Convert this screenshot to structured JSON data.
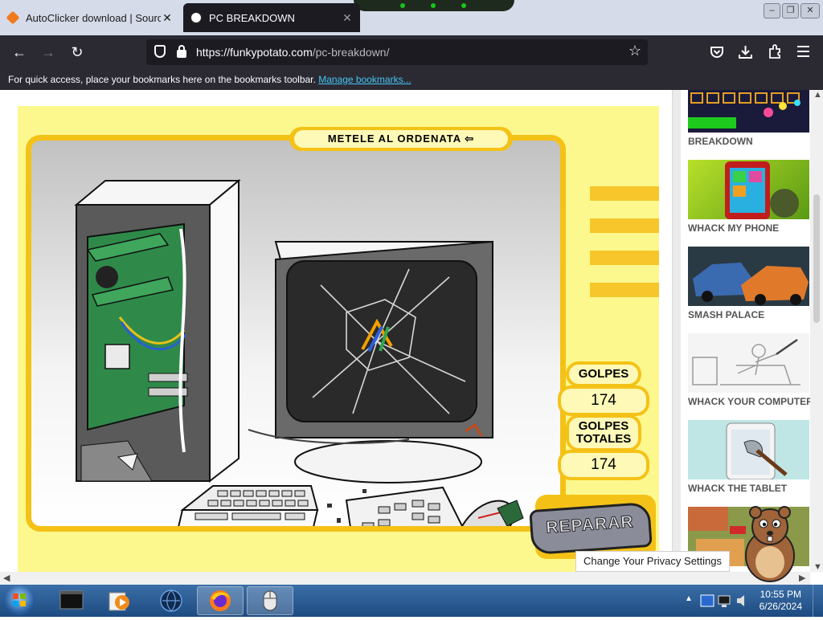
{
  "tabs": [
    {
      "title": "AutoClicker download | Sourcef",
      "close": "✕"
    },
    {
      "title": "PC BREAKDOWN",
      "close": "✕"
    }
  ],
  "window_controls": {
    "minimize": "–",
    "maximize": "❐",
    "close": "✕"
  },
  "nav": {
    "back": "←",
    "forward": "→",
    "reload": "↻"
  },
  "url": {
    "domain": "https://funkypotato.com",
    "path": "/pc-breakdown/"
  },
  "toolbar_icons": [
    "pocket-icon",
    "download-icon",
    "extensions-icon",
    "menu-icon"
  ],
  "bookmarks_bar": {
    "message": "For quick access, place your bookmarks here on the bookmarks toolbar.",
    "link": "Manage bookmarks..."
  },
  "game": {
    "title": "METELE AL ORDENATA",
    "hits_label": "GOLPES",
    "hits_value": "174",
    "total_label_line1": "GOLPES",
    "total_label_line2": "TOTALES",
    "total_value": "174",
    "repair_button": "REPARAR"
  },
  "sidebar": {
    "games": [
      {
        "name": "BREAKDOWN"
      },
      {
        "name": "WHACK MY PHONE"
      },
      {
        "name": "SMASH PALACE"
      },
      {
        "name": "WHACK YOUR COMPUTER"
      },
      {
        "name": "WHACK THE TABLET"
      }
    ]
  },
  "privacy_button": "Change Your Privacy Settings",
  "taskbar": {
    "apps": [
      "terminal-app",
      "media-player-app",
      "browser-globe-app",
      "firefox-app",
      "mouse-app"
    ],
    "time": "10:55 PM",
    "date": "6/26/2024"
  },
  "colors": {
    "game_yellow": "#f4c217",
    "game_bg": "#fdf88d",
    "chrome_dark": "#2b2a33",
    "link_blue": "#45c6f5"
  }
}
